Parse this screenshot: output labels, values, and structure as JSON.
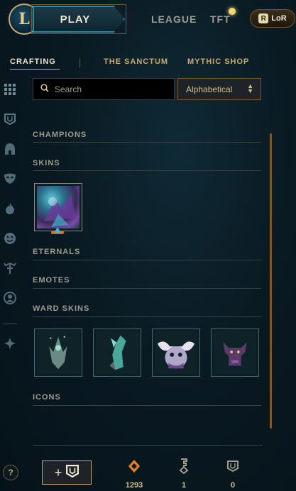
{
  "header": {
    "logo_letter": "L",
    "play_label": "PLAY",
    "nav": [
      "LEAGUE",
      "TFT"
    ],
    "lor_label": "LoR"
  },
  "tabs": [
    {
      "label": "CRAFTING",
      "active": true
    },
    {
      "label": "THE SANCTUM",
      "active": false
    },
    {
      "label": "MYTHIC SHOP",
      "active": false
    }
  ],
  "rail_icons": [
    "grid-icon",
    "crest-icon",
    "helmet-icon",
    "mask-icon",
    "flame-icon",
    "emote-icon",
    "ward-icon",
    "profile-icon",
    "chroma-icon"
  ],
  "search": {
    "placeholder": "Search",
    "value": ""
  },
  "sort": {
    "selected": "Alphabetical"
  },
  "sections": {
    "champions": "CHAMPIONS",
    "skins": "SKINS",
    "eternals": "ETERNALS",
    "emotes": "EMOTES",
    "ward_skins": "WARD SKINS",
    "icons": "ICONS"
  },
  "skin_items": [
    {
      "name": "skin-tile",
      "colors": [
        "#2b6f8a",
        "#7a4aa8",
        "#3fb0c8"
      ]
    }
  ],
  "ward_items": [
    {
      "name": "ward-tile-1",
      "color": "#6a8a84"
    },
    {
      "name": "ward-tile-2",
      "color": "#4aa89a"
    },
    {
      "name": "ward-tile-3",
      "color": "#b0a8c8"
    },
    {
      "name": "ward-tile-4",
      "color": "#5a3a6a"
    }
  ],
  "footer": {
    "help_label": "?",
    "add_label": "+",
    "currencies": [
      {
        "icon": "orange-essence-icon",
        "value": "1293",
        "color": "#e8822a"
      },
      {
        "icon": "key-icon",
        "value": "1",
        "color": "#a09b8c"
      },
      {
        "icon": "chest-icon",
        "value": "0",
        "color": "#a09b8c"
      }
    ]
  },
  "colors": {
    "gold": "#c8aa6e",
    "accent_blue": "#1a8fa8",
    "background": "#0a1a22"
  }
}
